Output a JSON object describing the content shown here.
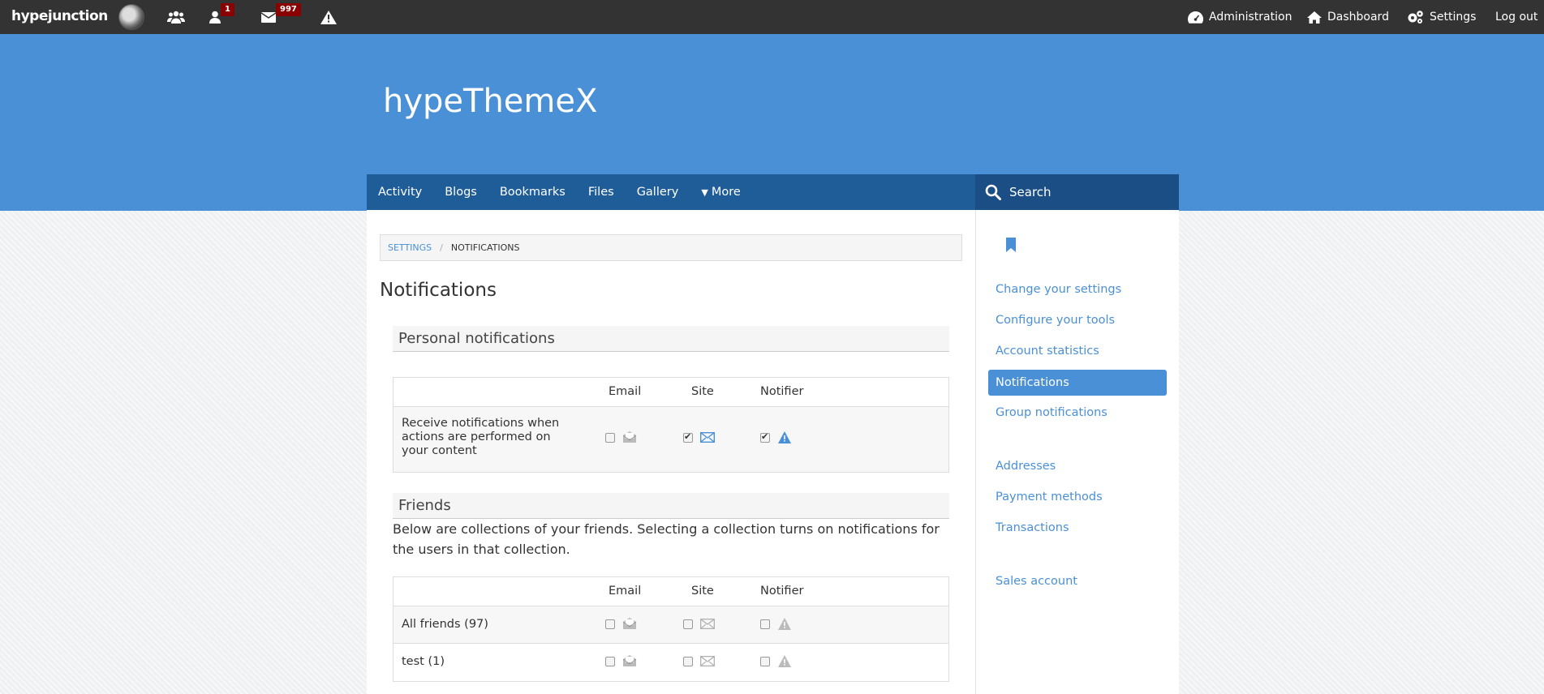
{
  "topbar": {
    "logo": "hypejunction",
    "badges": {
      "friends": "1",
      "messages": "997"
    },
    "links": {
      "administration": "Administration",
      "dashboard": "Dashboard",
      "settings": "Settings",
      "logout": "Log out"
    }
  },
  "header": {
    "site_title": "hypeThemeX"
  },
  "nav": {
    "items": [
      "Activity",
      "Blogs",
      "Bookmarks",
      "Files",
      "Gallery"
    ],
    "more": "More",
    "search_label": "Search"
  },
  "breadcrumb": {
    "parent": "Settings",
    "current": "Notifications"
  },
  "page_title": "Notifications",
  "personal": {
    "heading": "Personal notifications",
    "columns": [
      "Email",
      "Site",
      "Notifier"
    ],
    "row_label": "Receive notifications when actions are performed on your content",
    "email": false,
    "site": true,
    "notifier": true
  },
  "friends": {
    "heading": "Friends",
    "description": "Below are collections of your friends. Selecting a collection turns on notifications for the users in that collection.",
    "columns": [
      "Email",
      "Site",
      "Notifier"
    ],
    "rows": [
      {
        "label": "All friends (97)",
        "email": false,
        "site": false,
        "notifier": false
      },
      {
        "label": "test (1)",
        "email": false,
        "site": false,
        "notifier": false
      }
    ]
  },
  "sidebar": {
    "links": [
      "Change your settings",
      "Configure your tools",
      "Account statistics"
    ],
    "active": "Notifications",
    "links2": [
      "Group notifications"
    ],
    "links3": [
      "Addresses",
      "Payment methods",
      "Transactions"
    ],
    "links4": [
      "Sales account"
    ]
  },
  "colors": {
    "accent": "#4a90d6",
    "nav": "#1f5d99",
    "topbar": "#333333",
    "badge": "#8b0000"
  }
}
